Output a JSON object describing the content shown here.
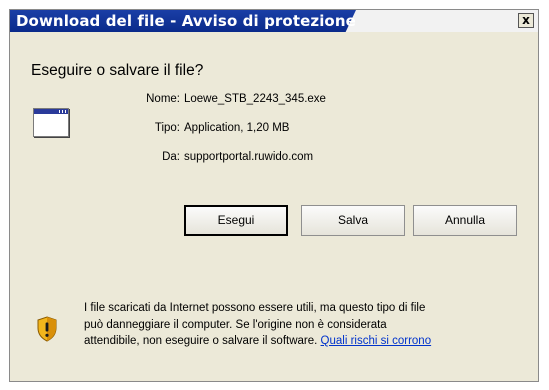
{
  "window": {
    "title": "Download del file - Avviso di protezione",
    "close_label": "x"
  },
  "prompt": {
    "question": "Eseguire o salvare il file?"
  },
  "file_info": {
    "name_label": "Nome:",
    "name_value": "Loewe_STB_2243_345.exe",
    "type_label": "Tipo:",
    "type_value": "Application, 1,20 MB",
    "from_label": "Da:",
    "from_value": "supportportal.ruwido.com"
  },
  "buttons": {
    "run": "Esegui",
    "save": "Salva",
    "cancel": "Annulla"
  },
  "warning": {
    "line1": "I file scaricati da Internet possono essere utili, ma questo tipo di file",
    "line2": "può danneggiare il computer. Se l'origine non è considerata",
    "line3_text": "attendibile, non eseguire o salvare il software. ",
    "link": "Quali rischi si corrono"
  },
  "colors": {
    "titlebar": "#0a2a8a",
    "dialog_bg": "#ece9d8",
    "link": "#0033cc"
  },
  "icons": {
    "file": "application-window-icon",
    "warning": "security-shield-icon"
  }
}
